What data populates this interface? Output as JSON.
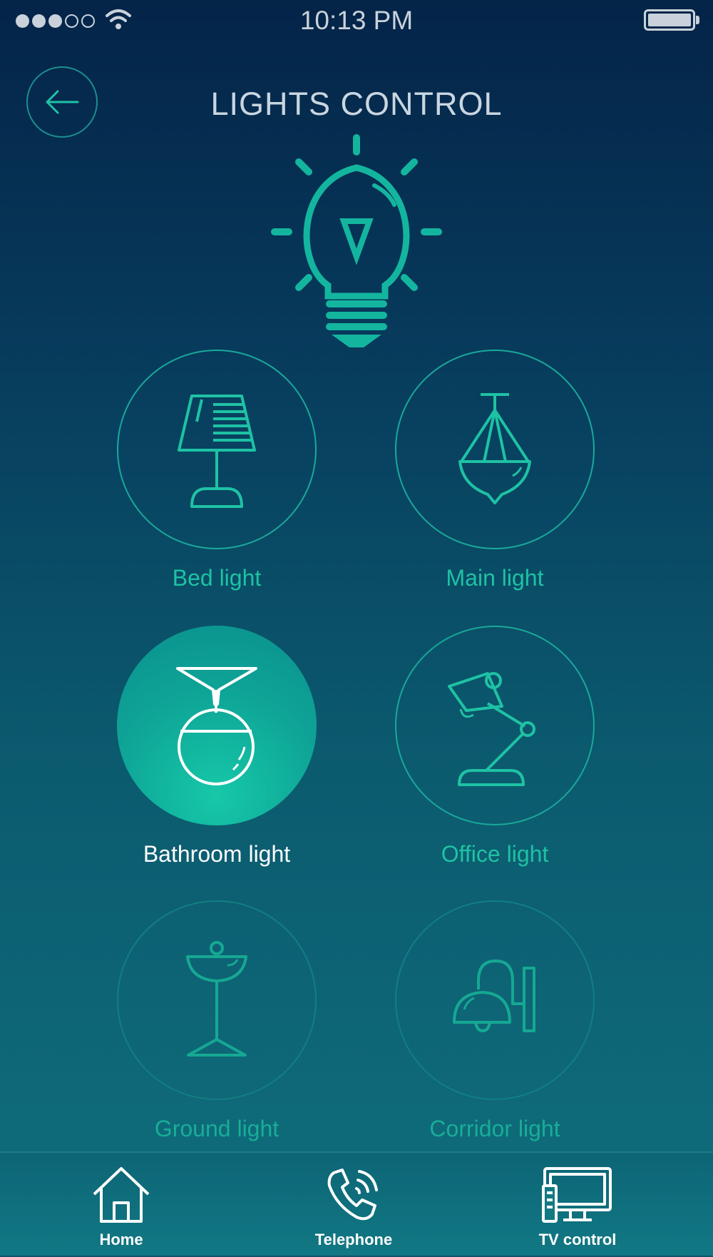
{
  "status_bar": {
    "time": "10:13 PM"
  },
  "header": {
    "title": "LIGHTS CONTROL"
  },
  "lights": [
    {
      "label": "Bed light",
      "icon": "bed-lamp-icon",
      "state": "off"
    },
    {
      "label": "Main light",
      "icon": "chandelier-icon",
      "state": "off"
    },
    {
      "label": "Bathroom light",
      "icon": "pendant-globe-icon",
      "state": "on"
    },
    {
      "label": "Office light",
      "icon": "desk-lamp-icon",
      "state": "off"
    },
    {
      "label": "Ground light",
      "icon": "floor-lamp-icon",
      "state": "off"
    },
    {
      "label": "Corridor light",
      "icon": "wall-sconce-icon",
      "state": "off"
    }
  ],
  "nav": {
    "home": "Home",
    "telephone": "Telephone",
    "tv": "TV control"
  },
  "colors": {
    "accent": "#1ec2a4",
    "active_fill": "#0ea396",
    "text": "#c9d6e0"
  }
}
